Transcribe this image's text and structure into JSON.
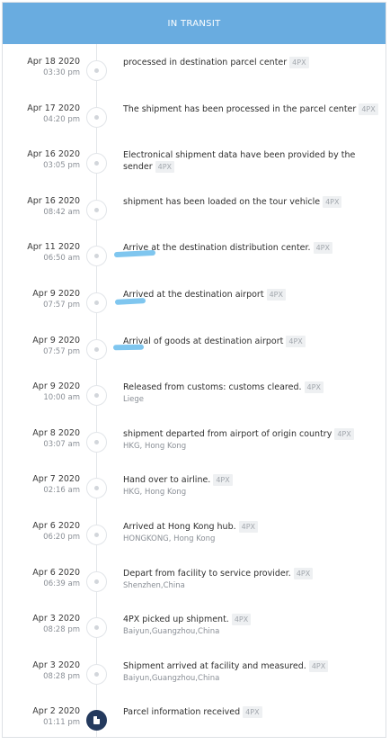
{
  "header": {
    "title": "IN TRANSIT"
  },
  "events": [
    {
      "date": "Apr 18 2020",
      "time": "03:30 pm",
      "description": "processed in destination parcel center",
      "carrier": "4PX",
      "location": ""
    },
    {
      "date": "Apr 17 2020",
      "time": "04:20 pm",
      "description": "The shipment has been processed in the parcel center",
      "carrier": "4PX",
      "location": ""
    },
    {
      "date": "Apr 16 2020",
      "time": "03:05 pm",
      "description": "Electronical shipment data have been provided by the sender",
      "carrier": "4PX",
      "location": ""
    },
    {
      "date": "Apr 16 2020",
      "time": "08:42 am",
      "description": "shipment has been loaded on the tour vehicle",
      "carrier": "4PX",
      "location": ""
    },
    {
      "date": "Apr 11 2020",
      "time": "06:50 am",
      "description": "Arrive at the destination distribution center.",
      "carrier": "4PX",
      "location": ""
    },
    {
      "date": "Apr 9 2020",
      "time": "07:57 pm",
      "description": "Arrived at the destination airport",
      "carrier": "4PX",
      "location": ""
    },
    {
      "date": "Apr 9 2020",
      "time": "07:57 pm",
      "description": "Arrival of goods at destination airport",
      "carrier": "4PX",
      "location": ""
    },
    {
      "date": "Apr 9 2020",
      "time": "10:00 am",
      "description": "Released from customs: customs cleared.",
      "carrier": "4PX",
      "location": "Liege"
    },
    {
      "date": "Apr 8 2020",
      "time": "03:07 am",
      "description": "shipment departed from airport of origin country",
      "carrier": "4PX",
      "location": "HKG, Hong Kong"
    },
    {
      "date": "Apr 7 2020",
      "time": "02:16 am",
      "description": "Hand over to airline.",
      "carrier": "4PX",
      "location": "HKG, Hong Kong"
    },
    {
      "date": "Apr 6 2020",
      "time": "06:20 pm",
      "description": "Arrived at Hong Kong hub.",
      "carrier": "4PX",
      "location": "HONGKONG, Hong Kong"
    },
    {
      "date": "Apr 6 2020",
      "time": "06:39 am",
      "description": "Depart from facility to service provider.",
      "carrier": "4PX",
      "location": "Shenzhen,China"
    },
    {
      "date": "Apr 3 2020",
      "time": "08:28 pm",
      "description": "4PX picked up shipment.",
      "carrier": "4PX",
      "location": "Baiyun,Guangzhou,China"
    },
    {
      "date": "Apr 3 2020",
      "time": "08:28 pm",
      "description": "Shipment arrived at facility and measured.",
      "carrier": "4PX",
      "location": "Baiyun,Guangzhou,China"
    },
    {
      "date": "Apr 2 2020",
      "time": "01:11 pm",
      "description": "Parcel information received",
      "carrier": "4PX",
      "location": ""
    }
  ],
  "colors": {
    "header": "#69ace0",
    "final_node": "#243a5e",
    "highlight": "#7fc6ef"
  }
}
